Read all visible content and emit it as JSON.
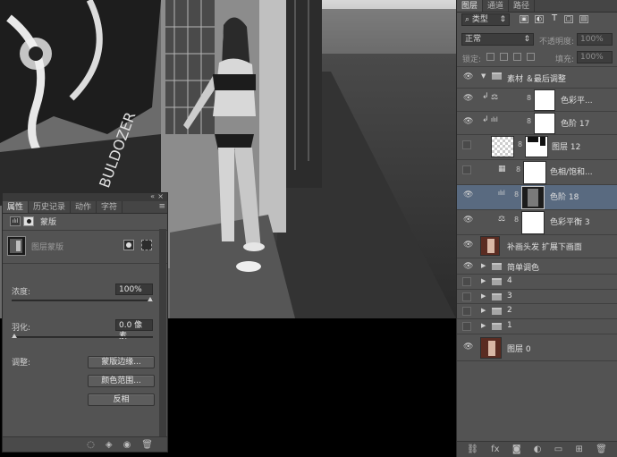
{
  "properties_panel": {
    "tabs": [
      "属性",
      "历史记录",
      "动作",
      "字符"
    ],
    "active_tab": "属性",
    "section_label": "蒙版",
    "mask_label": "图层蒙版",
    "density_label": "浓度:",
    "density_value": "100%",
    "density_level": 1.0,
    "feather_label": "羽化:",
    "feather_value": "0.0 像素",
    "feather_level": 0.0,
    "adjust_label": "调整:",
    "btn_mask_edge": "蒙版边缘...",
    "btn_color_range": "颜色范围...",
    "btn_invert": "反相",
    "collapse_glyph": "«",
    "close_glyph": "×",
    "menu_glyph": "≡"
  },
  "layers_panel": {
    "tabs": [
      "图层",
      "通道",
      "路径"
    ],
    "active_tab": "图层",
    "filter_kind": "类型",
    "blend_mode": "正常",
    "opacity_label": "不透明度:",
    "opacity_value": "100%",
    "lock_label": "锁定:",
    "fill_label": "填充:",
    "fill_value": "100%",
    "layers": [
      {
        "name": "素材 ＆最后调整",
        "type": "group-open",
        "visible": true
      },
      {
        "name": "色彩平...",
        "type": "adjustment",
        "icon": "balance-icon",
        "clipped": true,
        "visible": true
      },
      {
        "name": "色阶 17",
        "type": "adjustment",
        "icon": "levels-icon",
        "clipped": true,
        "visible": true
      },
      {
        "name": "图层 12",
        "type": "pixel-mask",
        "visible": false
      },
      {
        "name": "色相/饱和...",
        "type": "adjustment",
        "icon": "hue-icon",
        "visible": false
      },
      {
        "name": "色阶 18",
        "type": "adjustment",
        "icon": "levels-icon",
        "visible": true,
        "selected": true
      },
      {
        "name": "色彩平衡 3",
        "type": "adjustment",
        "icon": "balance-icon",
        "visible": true
      },
      {
        "name": "补画头发 扩展下画面",
        "type": "pixel",
        "visible": true
      },
      {
        "name": "简单调色",
        "type": "group",
        "visible": true
      },
      {
        "name": "4",
        "type": "group",
        "visible": false
      },
      {
        "name": "3",
        "type": "group",
        "visible": false
      },
      {
        "name": "2",
        "type": "group",
        "visible": false
      },
      {
        "name": "1",
        "type": "group",
        "visible": false
      },
      {
        "name": "图层 0",
        "type": "pixel",
        "visible": true
      }
    ]
  },
  "icons": {
    "eye": "👁",
    "chain": "8",
    "clip": "↲",
    "levels": "ılıl",
    "balance": "⚖",
    "hue": "▦",
    "arrow_open": "▼",
    "arrow_closed": "▶"
  }
}
